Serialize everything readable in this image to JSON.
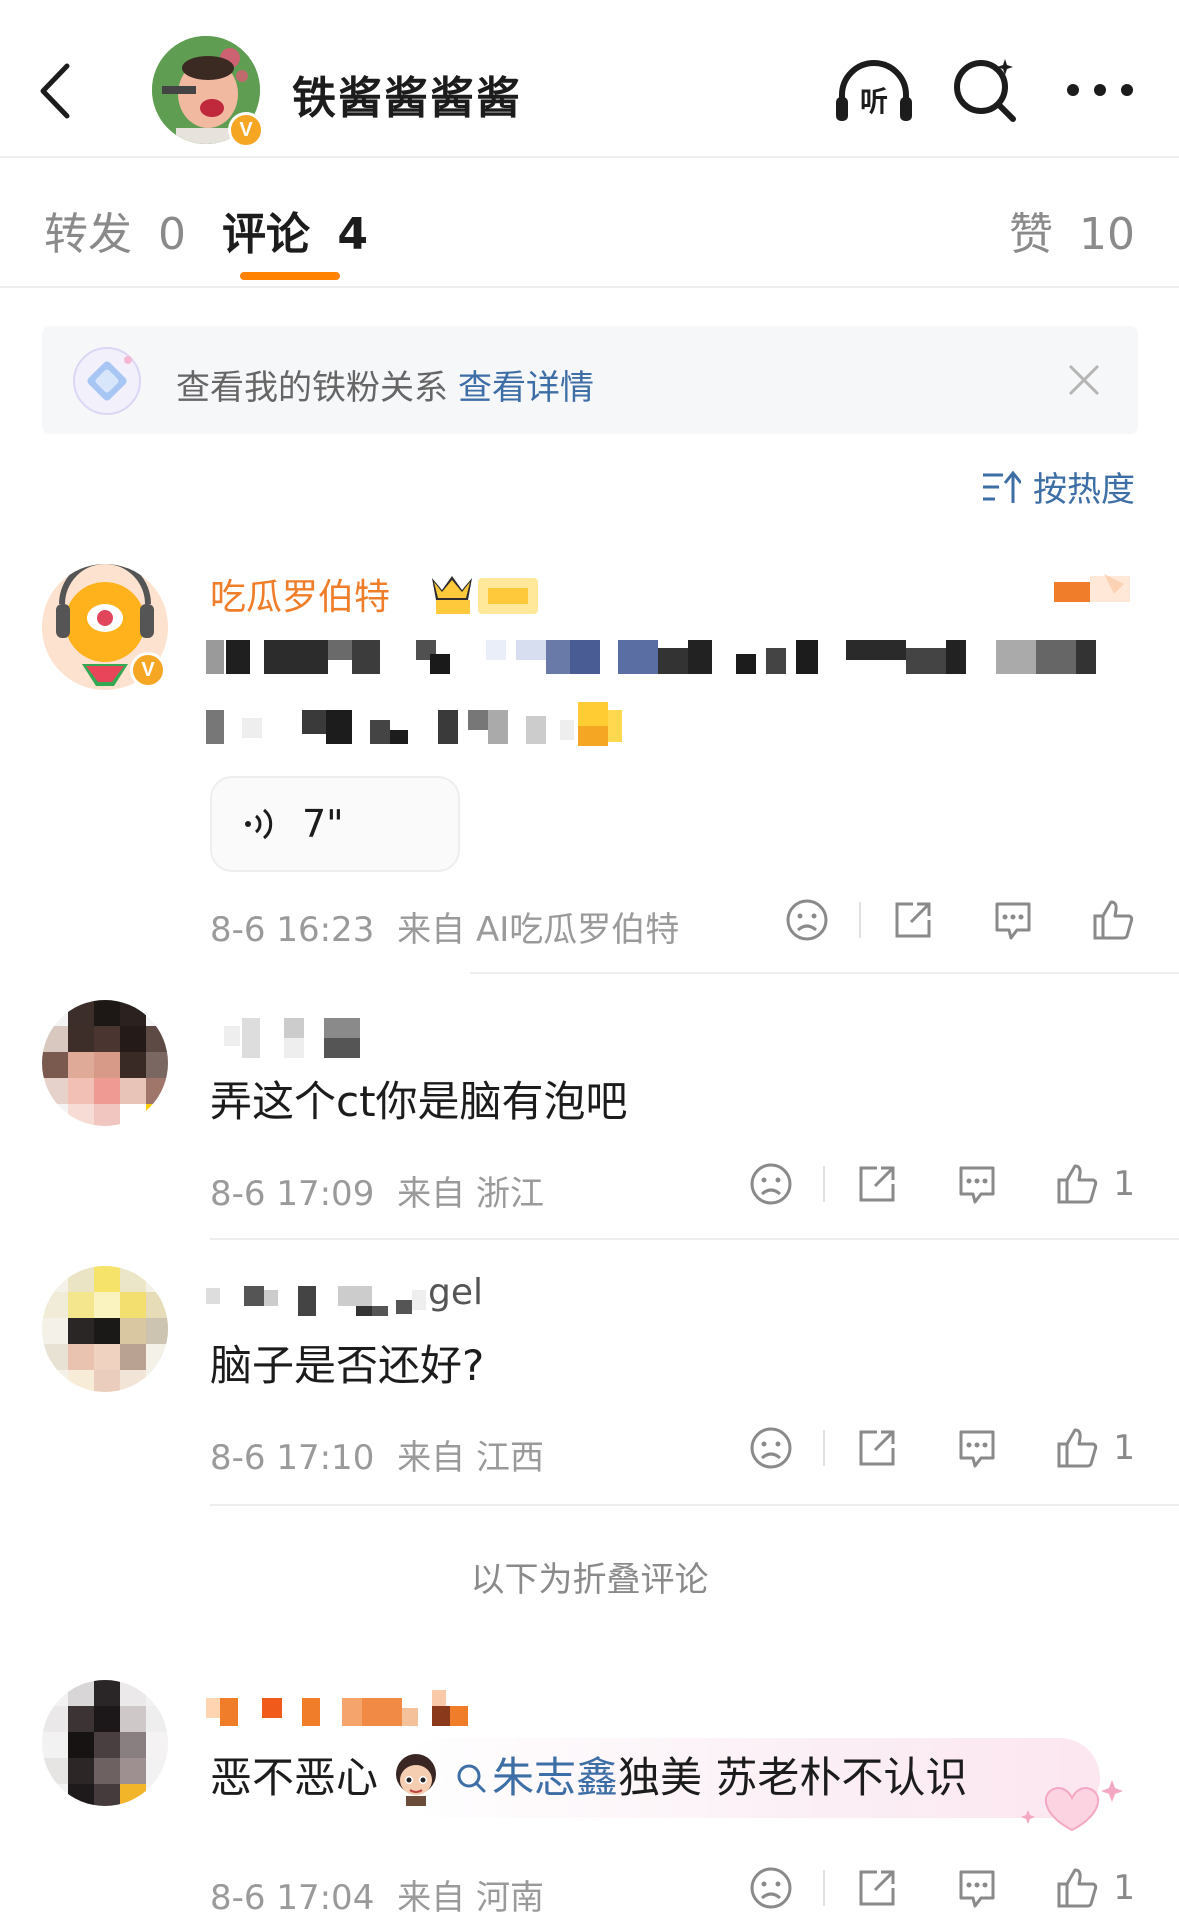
{
  "header": {
    "user_name": "铁酱酱酱酱",
    "icons": [
      "back-icon",
      "listen-icon",
      "search-icon",
      "more-icon"
    ],
    "listen_glyph": "听"
  },
  "tabs": [
    {
      "label": "转发",
      "count": "0"
    },
    {
      "label": "评论",
      "count": "4"
    },
    {
      "label": "赞",
      "count": "10"
    }
  ],
  "banner": {
    "text": "查看我的铁粉关系",
    "link": "查看详情"
  },
  "sort": {
    "label": "按热度"
  },
  "comments": [
    {
      "name": "吃瓜罗伯特",
      "voice_duration": "7\"",
      "time": "8-6 16:23",
      "source": "来自 AI吃瓜罗伯特",
      "likes": ""
    },
    {
      "name_suffix": "",
      "text": "弄这个ct你是脑有泡吧",
      "time": "8-6 17:09",
      "source": "来自 浙江",
      "likes": "1"
    },
    {
      "name_suffix": "gel",
      "text": "脑子是否还好?",
      "time": "8-6 17:10",
      "source": "来自 江西",
      "likes": "1"
    },
    {
      "text": "恶不恶心",
      "topic": "朱志鑫",
      "topic_rest": "独美 苏老朴不认识",
      "time": "8-6 17:04",
      "source": "来自 河南",
      "likes": "1"
    }
  ],
  "folded_notice": "以下为折叠评论",
  "colors": {
    "accent_orange": "#ff8200",
    "link_blue": "#3e6ea6",
    "name_orange": "#f07d2a",
    "vip_gold": "#f5a623"
  }
}
